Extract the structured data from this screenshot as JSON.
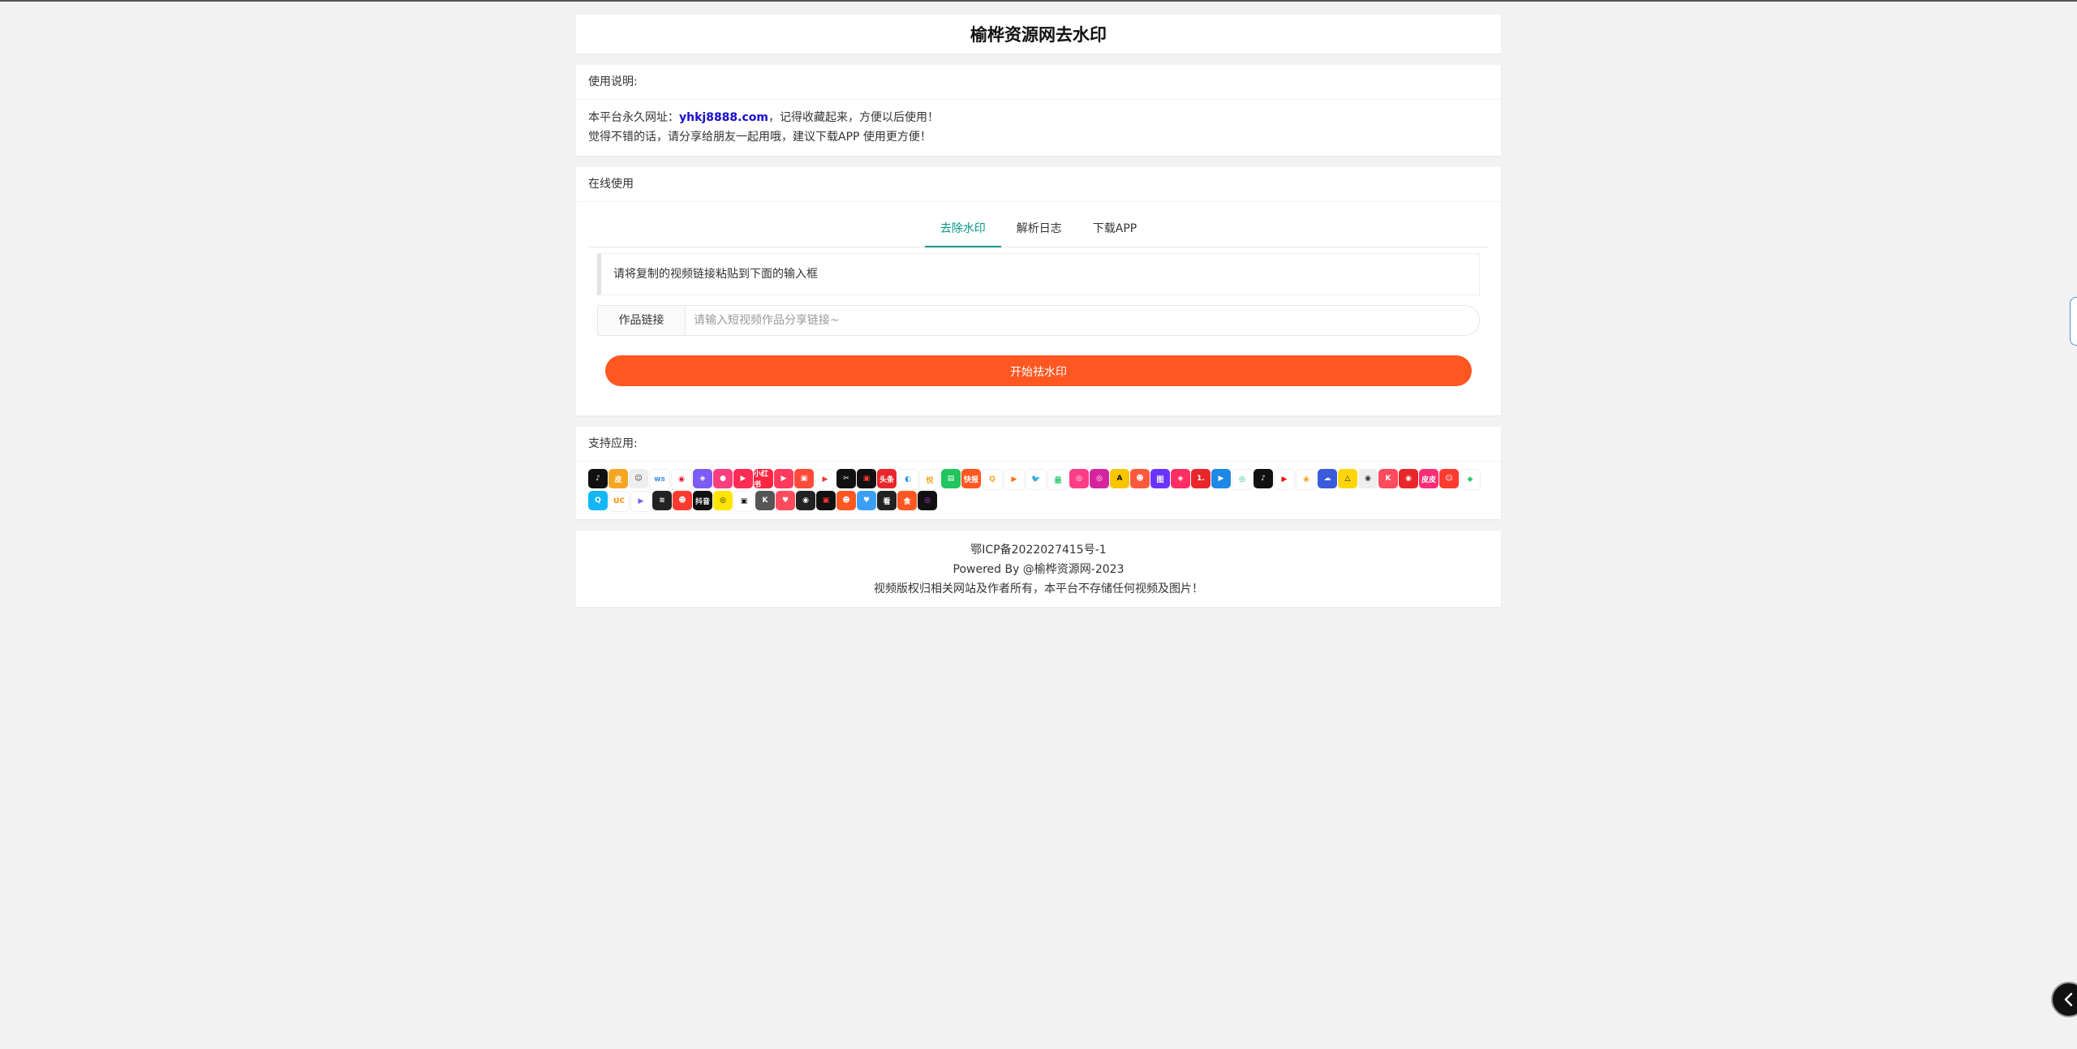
{
  "page": {
    "title": "榆桦资源网去水印"
  },
  "notice": {
    "heading": "使用说明:",
    "line1_prefix": "本平台永久网址：",
    "line1_link": "yhkj8888.com",
    "line1_suffix": "，记得收藏起来，方便以后使用！",
    "line2": "觉得不错的话，请分享给朋友一起用哦，建议下载APP 使用更方便！"
  },
  "online": {
    "heading": "在线使用",
    "tabs": [
      "去除水印",
      "解析日志",
      "下载APP"
    ],
    "active_tab": "去除水印",
    "hint": "请将复制的视频链接粘贴到下面的输入框",
    "input_label": "作品链接",
    "input_placeholder": "请输入短视频作品分享链接~",
    "input_value": "",
    "submit_label": "开始祛水印"
  },
  "apps": {
    "heading": "支持应用:",
    "icons": [
      {
        "name": "douyin",
        "bg": "#111111",
        "fg": "#ffffff",
        "glyph": "♪"
      },
      {
        "name": "pipixia",
        "bg": "#f5a623",
        "fg": "#ffffff",
        "glyph": "皮"
      },
      {
        "name": "kuaishou-face",
        "bg": "#eeeeee",
        "fg": "#333333",
        "glyph": "☺"
      },
      {
        "name": "weishi",
        "bg": "#ffffff",
        "fg": "#3b8ee8",
        "glyph": "ws"
      },
      {
        "name": "weibo",
        "bg": "#ffffff",
        "fg": "#e6162d",
        "glyph": "◉"
      },
      {
        "name": "lvzhou",
        "bg": "#7b5cf5",
        "fg": "#ffffff",
        "glyph": "◈"
      },
      {
        "name": "bilibili-pink",
        "bg": "#fb3e7d",
        "fg": "#ffffff",
        "glyph": "●"
      },
      {
        "name": "quanmin",
        "bg": "#ff2d55",
        "fg": "#ffffff",
        "glyph": "▶"
      },
      {
        "name": "xiaohongshu",
        "bg": "#ff2442",
        "fg": "#ffffff",
        "glyph": "小红书"
      },
      {
        "name": "meipai",
        "bg": "#ff3a5c",
        "fg": "#ffffff",
        "glyph": "▶"
      },
      {
        "name": "haokan",
        "bg": "#ff4b3a",
        "fg": "#ffffff",
        "glyph": "▣"
      },
      {
        "name": "play-triangle",
        "bg": "#ffffff",
        "fg": "#e53935",
        "glyph": "▶"
      },
      {
        "name": "jianying",
        "bg": "#111111",
        "fg": "#ffffff",
        "glyph": "✂"
      },
      {
        "name": "xigua",
        "bg": "#111111",
        "fg": "#ff3b30",
        "glyph": "▣"
      },
      {
        "name": "toutiao",
        "bg": "#e8262b",
        "fg": "#ffffff",
        "glyph": "头条"
      },
      {
        "name": "kuaishou-lite",
        "bg": "#ffffff",
        "fg": "#2196f3",
        "glyph": "◐"
      },
      {
        "name": "weiyue",
        "bg": "#ffffff",
        "fg": "#f5a623",
        "glyph": "悦"
      },
      {
        "name": "iqiyi-green",
        "bg": "#21c45d",
        "fg": "#ffffff",
        "glyph": "▤"
      },
      {
        "name": "kuaibao",
        "bg": "#ff5722",
        "fg": "#ffffff",
        "glyph": "快报"
      },
      {
        "name": "quwei",
        "bg": "#ffffff",
        "fg": "#f5a623",
        "glyph": "Q"
      },
      {
        "name": "momo-live",
        "bg": "#ffffff",
        "fg": "#ff6f00",
        "glyph": "▶"
      },
      {
        "name": "twitter",
        "bg": "#ffffff",
        "fg": "#1da1f2",
        "glyph": "🐦"
      },
      {
        "name": "zuiyou",
        "bg": "#ffffff",
        "fg": "#2ecc71",
        "glyph": "最"
      },
      {
        "name": "momo",
        "bg": "#ff3d87",
        "fg": "#ffffff",
        "glyph": "◎"
      },
      {
        "name": "instagram",
        "bg": "#d6249f",
        "fg": "#ffffff",
        "glyph": "◎"
      },
      {
        "name": "acfun",
        "bg": "#f7c600",
        "fg": "#111111",
        "glyph": "A"
      },
      {
        "name": "dayu",
        "bg": "#ff5a3c",
        "fg": "#ffffff",
        "glyph": "☻"
      },
      {
        "name": "tuchong",
        "bg": "#6a34ff",
        "fg": "#ffffff",
        "glyph": "图"
      },
      {
        "name": "youku",
        "bg": "#ff2e63",
        "fg": "#ffffff",
        "glyph": "◈"
      },
      {
        "name": "yidian",
        "bg": "#e8262b",
        "fg": "#ffffff",
        "glyph": "1."
      },
      {
        "name": "tencent-video",
        "bg": "#1e88e5",
        "fg": "#ffffff",
        "glyph": "▶"
      },
      {
        "name": "iqiyi",
        "bg": "#ffffff",
        "fg": "#00c060",
        "glyph": "◎"
      },
      {
        "name": "tiktok",
        "bg": "#111111",
        "fg": "#ffffff",
        "glyph": "♪"
      },
      {
        "name": "youtube",
        "bg": "#ffffff",
        "fg": "#ff0000",
        "glyph": "▶"
      },
      {
        "name": "weibo-story",
        "bg": "#ffffff",
        "fg": "#f5a623",
        "glyph": "◉"
      },
      {
        "name": "qq-chat",
        "bg": "#3b5bdb",
        "fg": "#ffffff",
        "glyph": "☁"
      },
      {
        "name": "shuabao",
        "bg": "#ffd60a",
        "fg": "#111111",
        "glyph": "△"
      },
      {
        "name": "eye-app",
        "bg": "#eeeeee",
        "fg": "#333333",
        "glyph": "◉"
      },
      {
        "name": "kge",
        "bg": "#ff4b5c",
        "fg": "#ffffff",
        "glyph": "K"
      },
      {
        "name": "netease-music",
        "bg": "#e8262b",
        "fg": "#ffffff",
        "glyph": "◉"
      },
      {
        "name": "pipigx",
        "bg": "#ff2d75",
        "fg": "#ffffff",
        "glyph": "皮皮"
      },
      {
        "name": "meishi",
        "bg": "#ff3b30",
        "fg": "#ffffff",
        "glyph": "☺"
      },
      {
        "name": "lvdou",
        "bg": "#ffffff",
        "fg": "#2ecc71",
        "glyph": "◆"
      },
      {
        "name": "qq",
        "bg": "#12b7f5",
        "fg": "#ffffff",
        "glyph": "Q"
      },
      {
        "name": "uc",
        "bg": "#ffffff",
        "fg": "#ff8c00",
        "glyph": "UC"
      },
      {
        "name": "zhibo",
        "bg": "#ffffff",
        "fg": "#7b5cf5",
        "glyph": "▶"
      },
      {
        "name": "lofter",
        "bg": "#222222",
        "fg": "#ffffff",
        "glyph": "≋"
      },
      {
        "name": "huya",
        "bg": "#ff3b30",
        "fg": "#ffffff",
        "glyph": "☻"
      },
      {
        "name": "fanqie",
        "bg": "#111111",
        "fg": "#ffffff",
        "glyph": "抖音"
      },
      {
        "name": "douyin-lite",
        "bg": "#ffe600",
        "fg": "#111111",
        "glyph": "◎"
      },
      {
        "name": "dy-black",
        "bg": "#ffffff",
        "fg": "#111111",
        "glyph": "▣"
      },
      {
        "name": "kwai",
        "bg": "#555555",
        "fg": "#ffffff",
        "glyph": "K"
      },
      {
        "name": "douyu",
        "bg": "#ff4b5c",
        "fg": "#ffffff",
        "glyph": "♥"
      },
      {
        "name": "tiktok-lite",
        "bg": "#222222",
        "fg": "#ffffff",
        "glyph": "◉"
      },
      {
        "name": "zhiyin",
        "bg": "#111111",
        "fg": "#ff3b30",
        "glyph": "▣"
      },
      {
        "name": "huoshan",
        "bg": "#ff5722",
        "fg": "#ffffff",
        "glyph": "☻"
      },
      {
        "name": "weixin-video",
        "bg": "#3aa0f5",
        "fg": "#ffffff",
        "glyph": "♥"
      },
      {
        "name": "kankan",
        "bg": "#222222",
        "fg": "#ffffff",
        "glyph": "看"
      },
      {
        "name": "shipin",
        "bg": "#ff5722",
        "fg": "#ffffff",
        "glyph": "食"
      },
      {
        "name": "circle-app",
        "bg": "#111111",
        "fg": "#d63af9",
        "glyph": "◎"
      }
    ]
  },
  "footer": {
    "icp": "鄂ICP备2022027415号-1",
    "powered": "Powered By @榆桦资源网-2023",
    "disclaimer": "视频版权归相关网站及作者所有，本平台不存储任何视频及图片！"
  }
}
